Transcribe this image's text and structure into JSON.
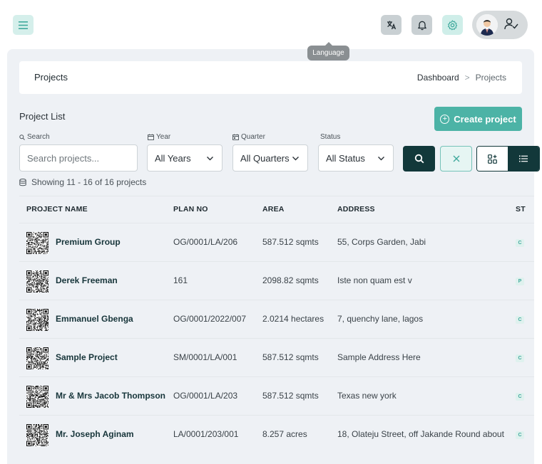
{
  "header": {
    "tooltip": "Language",
    "icons": [
      "menu-icon",
      "translate-icon",
      "bell-icon",
      "gear-icon",
      "user-check-icon"
    ]
  },
  "breadcrumb": {
    "title": "Projects",
    "home": "Dashboard",
    "separator": ">",
    "current": "Projects"
  },
  "list": {
    "title": "Project List",
    "create_label": "Create project",
    "showing": "Showing 11 - 16 of 16 projects"
  },
  "filters": {
    "search_label": "Search",
    "search_placeholder": "Search projects...",
    "year_label": "Year",
    "year_value": "All Years",
    "quarter_label": "Quarter",
    "quarter_value": "All Quarters",
    "status_label": "Status",
    "status_value": "All Status"
  },
  "table": {
    "columns": [
      "PROJECT NAME",
      "PLAN NO",
      "AREA",
      "ADDRESS",
      "ST"
    ],
    "rows": [
      {
        "name": "Premium Group",
        "plan": "OG/0001/LA/206",
        "area": "587.512 sqmts",
        "address": "55, Corps Garden, Jabi",
        "status": "C"
      },
      {
        "name": "Derek Freeman",
        "plan": "161",
        "area": "2098.82 sqmts",
        "address": "Iste non quam est v",
        "status": "P"
      },
      {
        "name": "Emmanuel Gbenga",
        "plan": "OG/0001/2022/007",
        "area": "2.0214 hectares",
        "address": "7, quenchy lane, lagos",
        "status": "C"
      },
      {
        "name": "Sample Project",
        "plan": "SM/0001/LA/001",
        "area": "587.512 sqmts",
        "address": "Sample Address Here",
        "status": "C"
      },
      {
        "name": "Mr & Mrs Jacob Thompson",
        "plan": "OG/0001/LA/203",
        "area": "587.512 sqmts",
        "address": "Texas new york",
        "status": "C"
      },
      {
        "name": "Mr. Joseph Aginam",
        "plan": "LA/0001/203/001",
        "area": "8.257 acres",
        "address": "18, Olateju Street, off Jakande Round about",
        "status": "C"
      }
    ]
  },
  "colors": {
    "accent": "#4cb3a6",
    "dark": "#12383a",
    "background": "#eef1f5"
  }
}
